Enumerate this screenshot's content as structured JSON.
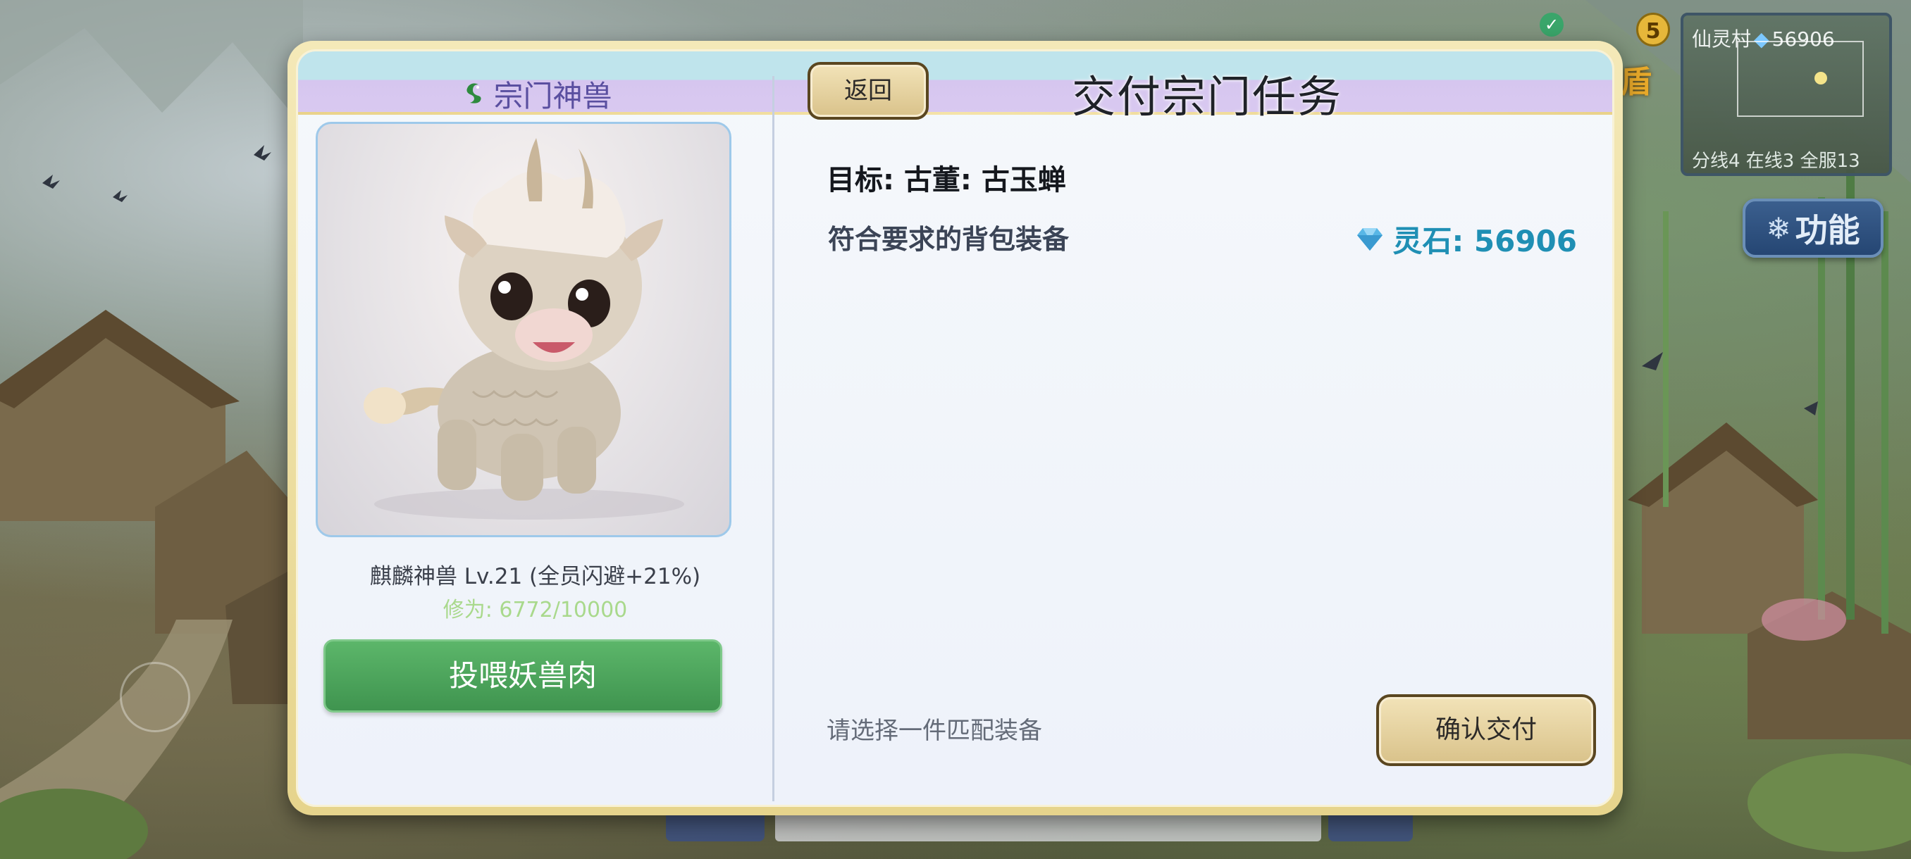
{
  "hud": {
    "minimap_location": "仙灵村",
    "minimap_stones": "56906",
    "minimap_status": "分线4 在线3 全服13",
    "notification_count": "5",
    "shield_label": "盾",
    "func_button_label": "功能"
  },
  "left_panel": {
    "title": "宗门神兽",
    "pet_name": "麒麟神兽 Lv.21 (全员闪避+21%)",
    "pet_xp": "修为: 6772/10000",
    "feed_button": "投喂妖兽肉"
  },
  "right_panel": {
    "back_button": "返回",
    "title": "交付宗门任务",
    "target": "目标: 古董: 古玉蝉",
    "requirement": "符合要求的背包装备",
    "stones_label": "灵石: 56906",
    "hint": "请选择一件匹配装备",
    "confirm_button": "确认交付"
  },
  "colors": {
    "accent_green": "#4ca65c",
    "accent_gold": "#e6d48c",
    "stone_blue": "#1f8fb4",
    "header_lavender": "#d6c6ef",
    "header_cyan": "#bfe4ec"
  },
  "icons": {
    "dragon": "dragon-icon",
    "gem": "gem-icon",
    "check": "check-icon",
    "snowflake": "snowflake-icon"
  }
}
